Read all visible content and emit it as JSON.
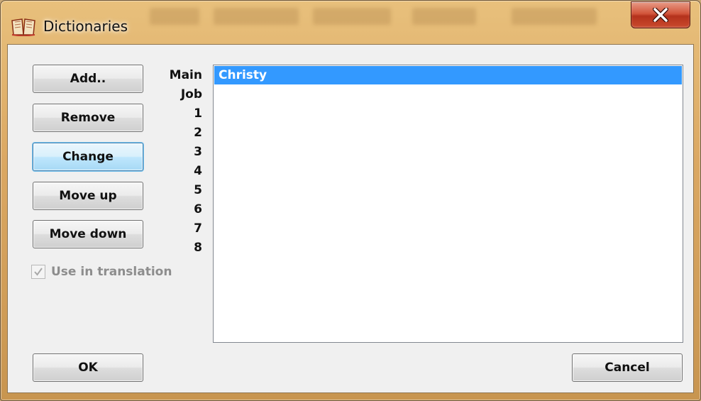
{
  "window": {
    "title": "Dictionaries",
    "icon": "open-book-icon",
    "close_icon": "close-x-icon",
    "close_color": "#c9492c"
  },
  "buttons": {
    "add": "Add..",
    "remove": "Remove",
    "change": "Change",
    "move_up": "Move up",
    "move_down": "Move down",
    "ok": "OK",
    "cancel": "Cancel"
  },
  "checkbox": {
    "label": "Use in translation",
    "checked": true,
    "enabled": false
  },
  "slot_labels": [
    "Main",
    "Job",
    "1",
    "2",
    "3",
    "4",
    "5",
    "6",
    "7",
    "8"
  ],
  "list": {
    "items": [
      "Christy"
    ],
    "selected_index": 0,
    "selection_color": "#3399ff"
  }
}
